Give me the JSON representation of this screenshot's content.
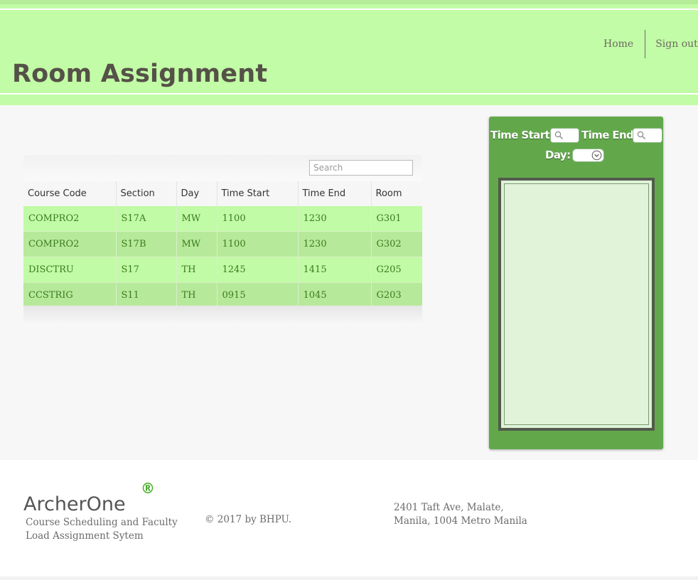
{
  "header": {
    "title": "Room Assignment",
    "nav": {
      "home": "Home",
      "signout": "Sign out"
    }
  },
  "table": {
    "search_placeholder": "Search",
    "columns": [
      "Course Code",
      "Section",
      "Day",
      "Time Start",
      "Time End",
      "Room"
    ],
    "rows": [
      [
        "COMPRO2",
        "S17A",
        "MW",
        "1100",
        "1230",
        "G301"
      ],
      [
        "COMPRO2",
        "S17B",
        "MW",
        "1100",
        "1230",
        "G302"
      ],
      [
        "DISCTRU",
        "S17",
        "TH",
        "1245",
        "1415",
        "G205"
      ],
      [
        "CCSTRIG",
        "S11",
        "TH",
        "0915",
        "1045",
        "G203"
      ]
    ]
  },
  "filter": {
    "time_start_label": "Time Start:",
    "time_end_label": "Time End:",
    "day_label": "Day:",
    "search_icon": "search-icon",
    "dropdown_icon": "chevron-down-circle-icon"
  },
  "footer": {
    "brand": "ArcherOne",
    "registered": "®",
    "tagline": "Course Scheduling and Faculty Load Assignment Sytem",
    "copyright": "© 2017 by BHPU.",
    "address": [
      "2401 Taft Ave, Malate,",
      "Manila, 1004 Metro Manila"
    ]
  },
  "colors": {
    "header_bg": "#c2fca6",
    "row_light": "#c1fba5",
    "row_dark": "#b7e99a",
    "panel_bg": "#62a84b",
    "text_dark": "#555148",
    "accent_green": "#4aac2a"
  }
}
